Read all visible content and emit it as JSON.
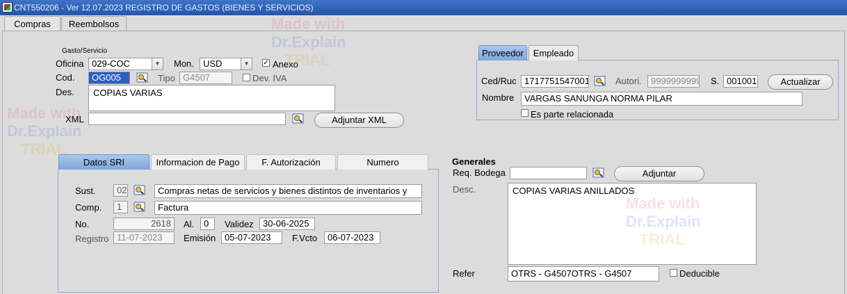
{
  "window": {
    "title": "CNT550206 - Ver 12.07.2023 REGISTRO DE GASTOS (BIENES Y SERVICIOS)"
  },
  "main_tabs": [
    {
      "label": "Compras",
      "active": true
    },
    {
      "label": "Reembolsos",
      "active": false
    }
  ],
  "gasto": {
    "group_label": "Gasto/Servicio",
    "oficina_label": "Oficina",
    "oficina_value": "029-COC",
    "mon_label": "Mon.",
    "mon_value": "USD",
    "anexo_label": "Anexo",
    "anexo_checked": true,
    "cod_label": "Cod.",
    "cod_value": "OG005",
    "tipo_label": "Tipo",
    "tipo_value": "G4507",
    "dev_iva_label": "Dev. IVA",
    "dev_iva_checked": false,
    "des_label": "Des.",
    "des_value": "COPIAS VARIAS",
    "xml_label": "XML",
    "xml_value": "",
    "adjuntar_xml_label": "Adjuntar XML"
  },
  "proveedor": {
    "tabs": [
      {
        "label": "Proveedor",
        "active": true
      },
      {
        "label": "Empleado",
        "active": false
      }
    ],
    "ced_ruc_label": "Ced/Ruc",
    "ced_ruc_value": "1717751547001",
    "autori_label": "Autori.",
    "autori_value": "9999999999",
    "s_label": "S.",
    "s_value": "001001",
    "actualizar_label": "Actualizar",
    "nombre_label": "Nombre",
    "nombre_value": "VARGAS SANUNGA NORMA PILAR",
    "parte_relacionada_label": "Es parte relacionada",
    "parte_relacionada_checked": false
  },
  "sri": {
    "tabs": [
      {
        "label": "Datos SRI",
        "active": true
      },
      {
        "label": "Informacion de Pago",
        "active": false
      },
      {
        "label": "F. Autorización",
        "active": false
      },
      {
        "label": "Numero",
        "active": false
      }
    ],
    "sust_label": "Sust.",
    "sust_code": "02",
    "sust_desc": "Compras netas de servicios y bienes distintos de inventarios y",
    "comp_label": "Comp.",
    "comp_code": "1",
    "comp_desc": "Factura",
    "no_label": "No.",
    "no_value": "2618",
    "al_label": "Al.",
    "al_value": "0",
    "validez_label": "Validez",
    "validez_value": "30-06-2025",
    "registro_label": "Registro",
    "registro_value": "11-07-2023",
    "emision_label": "Emisión",
    "emision_value": "05-07-2023",
    "fvcto_label": "F.Vcto",
    "fvcto_value": "06-07-2023"
  },
  "generales": {
    "heading": "Generales",
    "req_bodega_label": "Req. Bodega",
    "req_bodega_value": "",
    "adjuntar_label": "Adjuntar",
    "desc_label": "Desc.",
    "desc_value": "COPIAS VARIAS ANILLADOS",
    "refer_label": "Refer",
    "refer_value": "OTRS - G4507OTRS - G4507",
    "deducible_label": "Deducible",
    "deducible_checked": false
  },
  "watermark": {
    "line1": "Made with",
    "line2": "Dr.Explain",
    "line3": "TRIAL"
  },
  "colors": {
    "titlebar": "#2456a8",
    "selection": "#2b5fc2",
    "sri_tab_active": "#7fa6da",
    "background": "#dcdcdc"
  }
}
